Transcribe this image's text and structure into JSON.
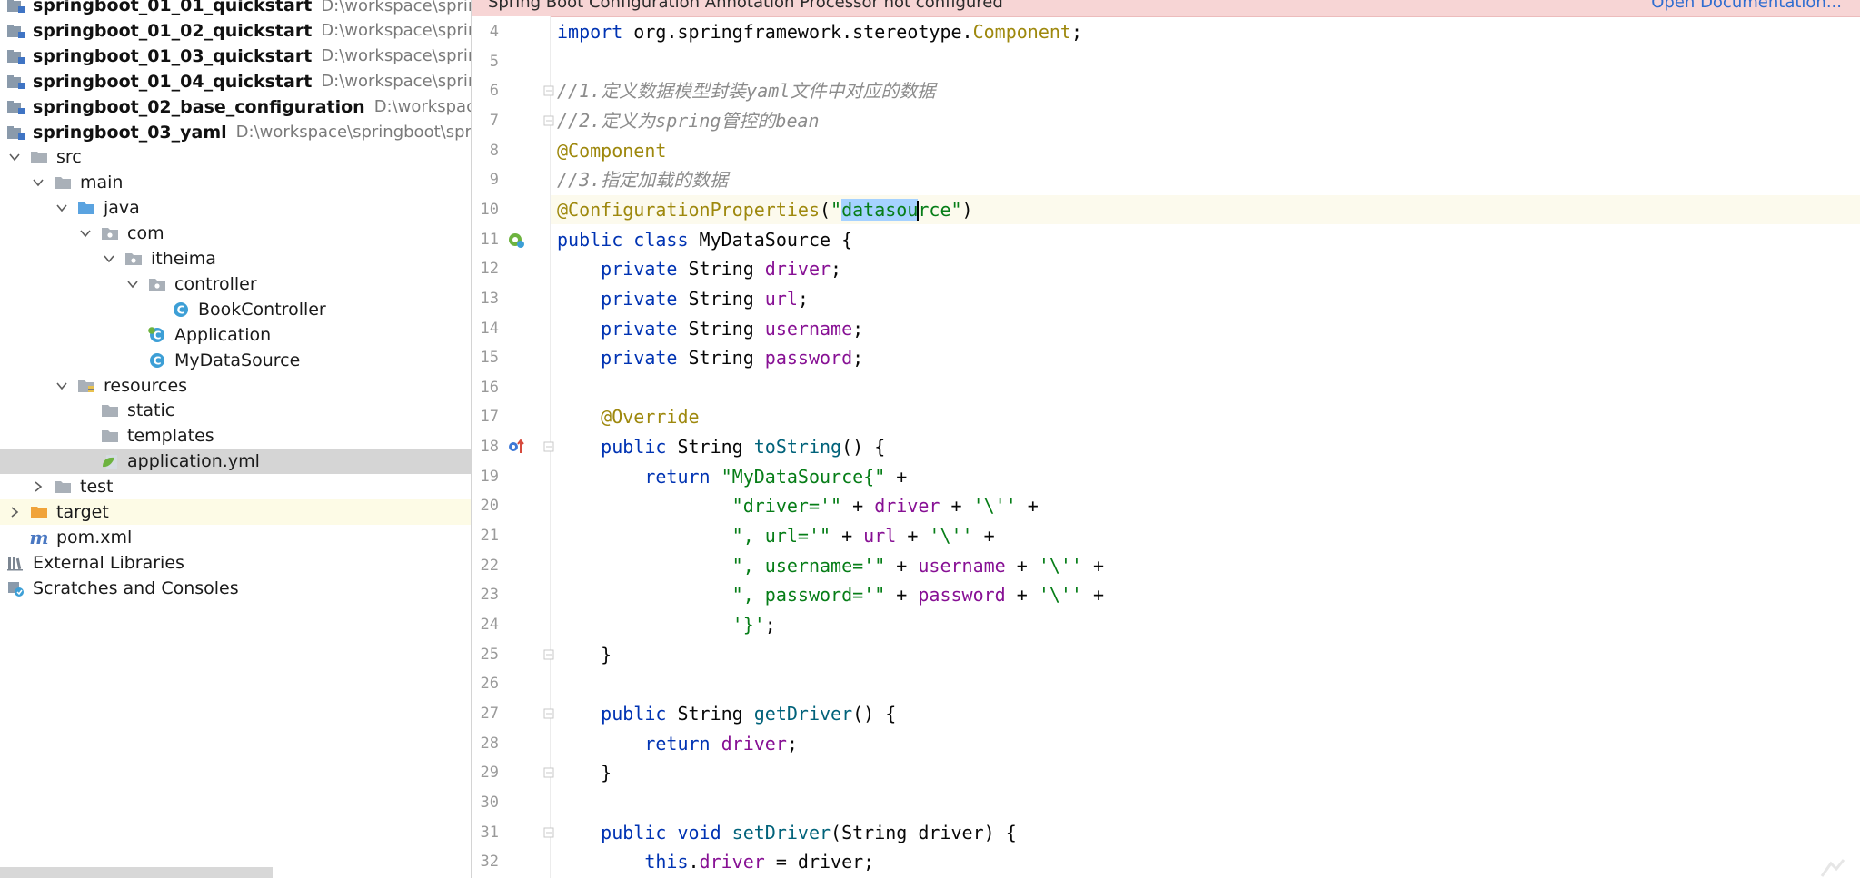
{
  "project_tree": [
    {
      "kind": "module",
      "name": "springboot_01_01_quickstart",
      "path": "D:\\workspace\\springboot",
      "depth": 0
    },
    {
      "kind": "module",
      "name": "springboot_01_02_quickstart",
      "path": "D:\\workspace\\springboot",
      "depth": 0
    },
    {
      "kind": "module",
      "name": "springboot_01_03_quickstart",
      "path": "D:\\workspace\\springboot",
      "depth": 0
    },
    {
      "kind": "module",
      "name": "springboot_01_04_quickstart",
      "path": "D:\\workspace\\springboot",
      "depth": 0
    },
    {
      "kind": "module",
      "name": "springboot_02_base_configuration",
      "path": "D:\\workspace\\springboot",
      "depth": 0
    },
    {
      "kind": "module",
      "name": "springboot_03_yaml",
      "path": "D:\\workspace\\springboot\\springb",
      "depth": 0
    },
    {
      "kind": "folder",
      "name": "src",
      "depth": 0,
      "expanded": true
    },
    {
      "kind": "folder",
      "name": "main",
      "depth": 1,
      "expanded": true
    },
    {
      "kind": "source-folder",
      "name": "java",
      "depth": 2,
      "expanded": true
    },
    {
      "kind": "package",
      "name": "com",
      "depth": 3,
      "expanded": true
    },
    {
      "kind": "package",
      "name": "itheima",
      "depth": 4,
      "expanded": true
    },
    {
      "kind": "package",
      "name": "controller",
      "depth": 5,
      "expanded": true
    },
    {
      "kind": "class",
      "name": "BookController",
      "depth": 6
    },
    {
      "kind": "spring-class",
      "name": "Application",
      "depth": 5
    },
    {
      "kind": "class",
      "name": "MyDataSource",
      "depth": 5
    },
    {
      "kind": "resources-folder",
      "name": "resources",
      "depth": 2,
      "expanded": true
    },
    {
      "kind": "folder",
      "name": "static",
      "depth": 3
    },
    {
      "kind": "folder",
      "name": "templates",
      "depth": 3
    },
    {
      "kind": "yaml-file",
      "name": "application.yml",
      "depth": 3,
      "selected": true
    },
    {
      "kind": "folder",
      "name": "test",
      "depth": 1,
      "expanded": false
    },
    {
      "kind": "target-folder",
      "name": "target",
      "depth": 0,
      "expanded": false,
      "highlighted": true
    },
    {
      "kind": "maven-file",
      "name": "pom.xml",
      "depth": 0
    },
    {
      "kind": "libraries",
      "name": "External Libraries",
      "depth": -1
    },
    {
      "kind": "scratches",
      "name": "Scratches and Consoles",
      "depth": -1
    }
  ],
  "banner": {
    "text": "Spring Boot Configuration Annotation Processor not configured",
    "link": "Open Documentation..."
  },
  "editor": {
    "lines": [
      {
        "n": "4",
        "tokens": [
          [
            "kw",
            "import "
          ],
          [
            "",
            "org.springframework.stereotype."
          ],
          [
            "an",
            "Component"
          ],
          [
            "",
            ";"
          ]
        ]
      },
      {
        "n": "5",
        "tokens": []
      },
      {
        "n": "6",
        "fold": true,
        "tokens": [
          [
            "cm",
            "//1.定义数据模型封装yaml文件中对应的数据"
          ]
        ]
      },
      {
        "n": "7",
        "fold": true,
        "tokens": [
          [
            "cm",
            "//2.定义为spring管控的bean"
          ]
        ]
      },
      {
        "n": "8",
        "tokens": [
          [
            "an",
            "@Component"
          ]
        ]
      },
      {
        "n": "9",
        "tokens": [
          [
            "cm",
            "//3.指定加载的数据"
          ]
        ]
      },
      {
        "n": "10",
        "current": true,
        "tokens": [
          [
            "an",
            "@ConfigurationProperties"
          ],
          [
            "",
            "("
          ],
          [
            "st",
            "\""
          ],
          [
            "st sel",
            "datasou"
          ],
          [
            "caret",
            ""
          ],
          [
            "st",
            "rce\""
          ],
          [
            "",
            ")"
          ]
        ]
      },
      {
        "n": "11",
        "icon": "bean-icon",
        "tokens": [
          [
            "kw",
            "public class "
          ],
          [
            "",
            "MyDataSource {"
          ]
        ]
      },
      {
        "n": "12",
        "tokens": [
          [
            "",
            "    "
          ],
          [
            "kw",
            "private "
          ],
          [
            "",
            "String "
          ],
          [
            "fld",
            "driver"
          ],
          [
            "",
            ";"
          ]
        ]
      },
      {
        "n": "13",
        "tokens": [
          [
            "",
            "    "
          ],
          [
            "kw",
            "private "
          ],
          [
            "",
            "String "
          ],
          [
            "fld",
            "url"
          ],
          [
            "",
            ";"
          ]
        ]
      },
      {
        "n": "14",
        "tokens": [
          [
            "",
            "    "
          ],
          [
            "kw",
            "private "
          ],
          [
            "",
            "String "
          ],
          [
            "fld",
            "username"
          ],
          [
            "",
            ";"
          ]
        ]
      },
      {
        "n": "15",
        "tokens": [
          [
            "",
            "    "
          ],
          [
            "kw",
            "private "
          ],
          [
            "",
            "String "
          ],
          [
            "fld",
            "password"
          ],
          [
            "",
            ";"
          ]
        ]
      },
      {
        "n": "16",
        "tokens": []
      },
      {
        "n": "17",
        "tokens": [
          [
            "",
            "    "
          ],
          [
            "an",
            "@Override"
          ]
        ]
      },
      {
        "n": "18",
        "icon": "override-icon",
        "fold": true,
        "tokens": [
          [
            "",
            "    "
          ],
          [
            "kw",
            "public "
          ],
          [
            "",
            "String "
          ],
          [
            "mth",
            "toString"
          ],
          [
            "",
            "() {"
          ]
        ]
      },
      {
        "n": "19",
        "tokens": [
          [
            "",
            "        "
          ],
          [
            "kw",
            "return "
          ],
          [
            "st",
            "\"MyDataSource{\""
          ],
          [
            "",
            " +"
          ]
        ]
      },
      {
        "n": "20",
        "tokens": [
          [
            "",
            "                "
          ],
          [
            "st",
            "\"driver='\""
          ],
          [
            "",
            " + "
          ],
          [
            "fld",
            "driver"
          ],
          [
            "",
            " + "
          ],
          [
            "st",
            "'\\''"
          ],
          [
            "",
            " +"
          ]
        ]
      },
      {
        "n": "21",
        "tokens": [
          [
            "",
            "                "
          ],
          [
            "st",
            "\", url='\""
          ],
          [
            "",
            " + "
          ],
          [
            "fld",
            "url"
          ],
          [
            "",
            " + "
          ],
          [
            "st",
            "'\\''"
          ],
          [
            "",
            " +"
          ]
        ]
      },
      {
        "n": "22",
        "tokens": [
          [
            "",
            "                "
          ],
          [
            "st",
            "\", username='\""
          ],
          [
            "",
            " + "
          ],
          [
            "fld",
            "username"
          ],
          [
            "",
            " + "
          ],
          [
            "st",
            "'\\''"
          ],
          [
            "",
            " +"
          ]
        ]
      },
      {
        "n": "23",
        "tokens": [
          [
            "",
            "                "
          ],
          [
            "st",
            "\", password='\""
          ],
          [
            "",
            " + "
          ],
          [
            "fld",
            "password"
          ],
          [
            "",
            " + "
          ],
          [
            "st",
            "'\\''"
          ],
          [
            "",
            " +"
          ]
        ]
      },
      {
        "n": "24",
        "tokens": [
          [
            "",
            "                "
          ],
          [
            "st",
            "'}'"
          ],
          [
            "",
            ";"
          ]
        ]
      },
      {
        "n": "25",
        "fold": true,
        "tokens": [
          [
            "",
            "    }"
          ]
        ]
      },
      {
        "n": "26",
        "tokens": []
      },
      {
        "n": "27",
        "fold": true,
        "tokens": [
          [
            "",
            "    "
          ],
          [
            "kw",
            "public "
          ],
          [
            "",
            "String "
          ],
          [
            "mth",
            "getDriver"
          ],
          [
            "",
            "() {"
          ]
        ]
      },
      {
        "n": "28",
        "tokens": [
          [
            "",
            "        "
          ],
          [
            "kw",
            "return "
          ],
          [
            "fld",
            "driver"
          ],
          [
            "",
            ";"
          ]
        ]
      },
      {
        "n": "29",
        "fold": true,
        "tokens": [
          [
            "",
            "    }"
          ]
        ]
      },
      {
        "n": "30",
        "tokens": []
      },
      {
        "n": "31",
        "fold": true,
        "tokens": [
          [
            "",
            "    "
          ],
          [
            "kw",
            "public void "
          ],
          [
            "mth",
            "setDriver"
          ],
          [
            "",
            "(String driver) {"
          ]
        ]
      },
      {
        "n": "32",
        "tokens": [
          [
            "",
            "        "
          ],
          [
            "kw",
            "this"
          ],
          [
            "",
            "."
          ],
          [
            "fld",
            "driver"
          ],
          [
            "",
            " = driver;"
          ]
        ]
      }
    ]
  }
}
